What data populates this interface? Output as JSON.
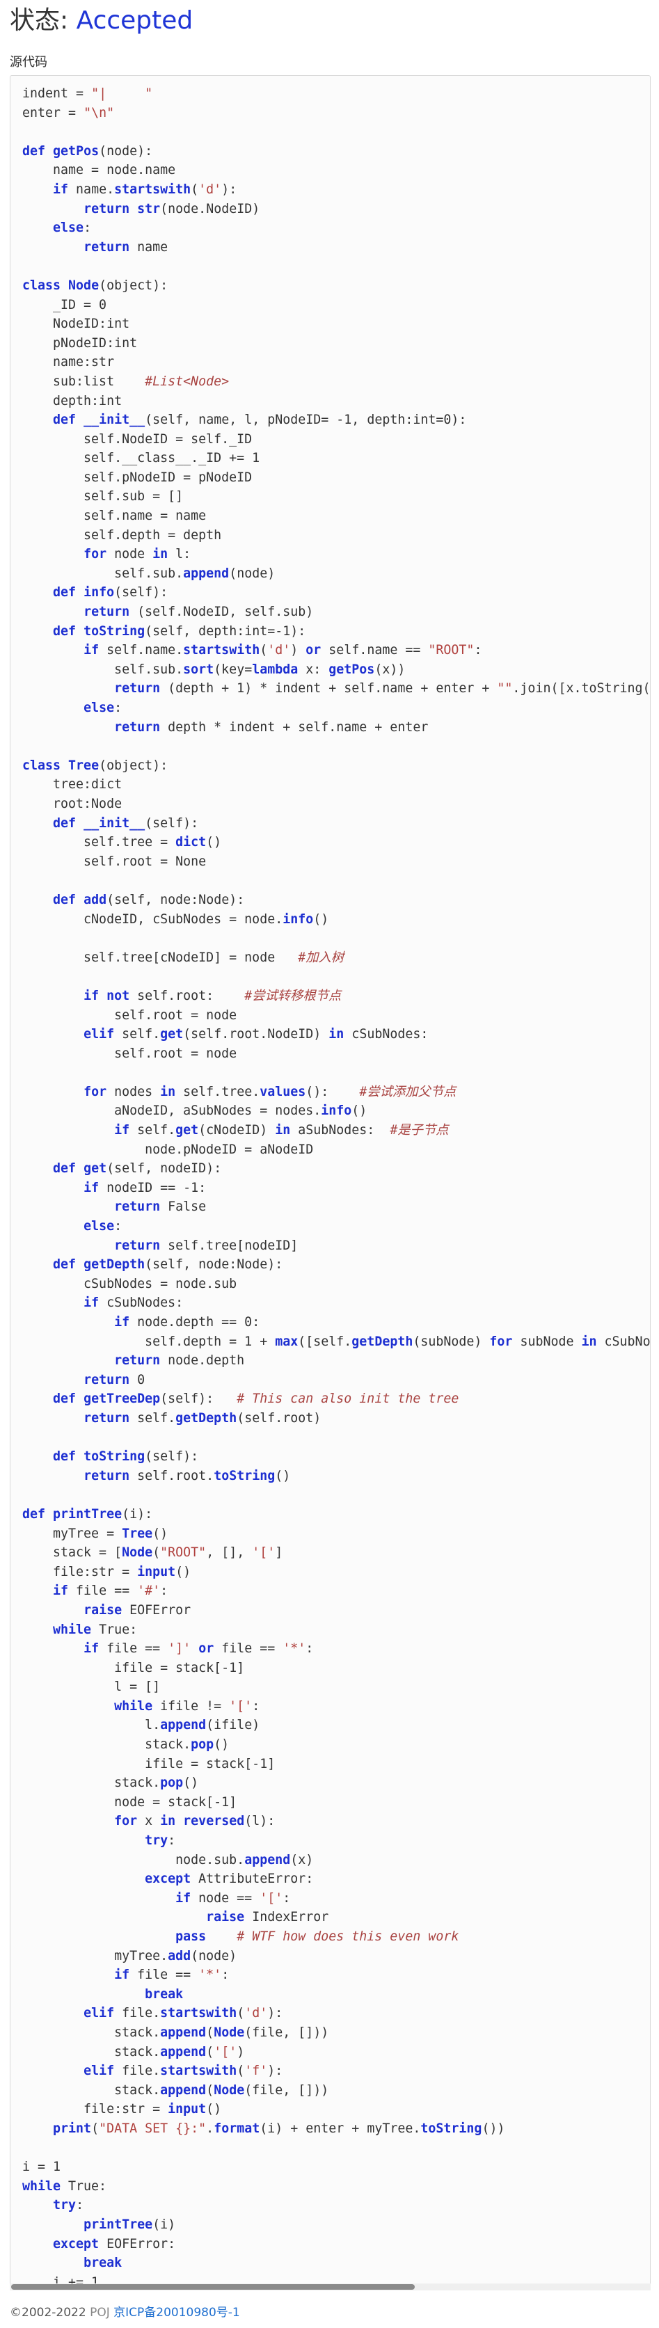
{
  "header": {
    "status_label": "状态: ",
    "status_value": "Accepted",
    "status_color": "#1f35d6"
  },
  "source": {
    "title": "源代码",
    "language": "python"
  },
  "footer": {
    "copyright": "©2002-2022 ",
    "site": "POJ",
    "icp": "京ICP备20010980号-1"
  }
}
